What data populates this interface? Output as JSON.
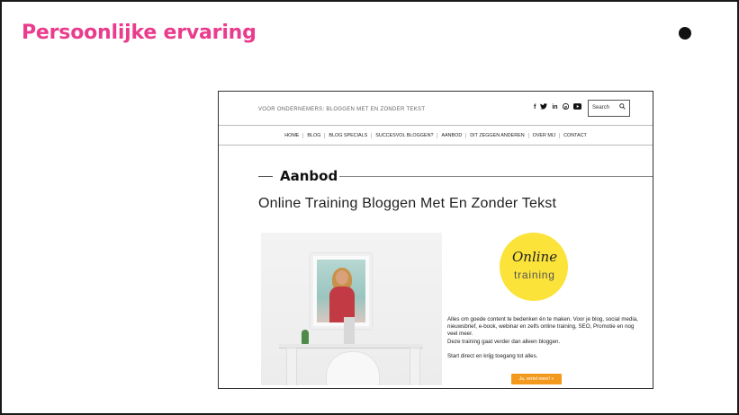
{
  "slide": {
    "title": "Persoonlijke ervaring"
  },
  "site": {
    "tagline": "VOOR ONDERNEMERS: BLOGGEN MET EN ZONDER TEKST",
    "social": [
      "f",
      "♥",
      "in",
      "℗",
      "■"
    ],
    "search_placeholder": "Search",
    "nav": [
      "HOME",
      "BLOG",
      "BLOG SPECIALS",
      "SUCCESVOL BLOGGEN?",
      "AANBOD",
      "DIT ZEGGEN ANDEREN",
      "OVER MIJ",
      "CONTACT"
    ],
    "section_label": "Aanbod",
    "page_heading": "Online Training Bloggen Met En Zonder Tekst",
    "logo": {
      "script": "Online",
      "word": "training"
    },
    "description": [
      "Alles om goede content te bedenken én te maken. Voor je blog, social media, nieuwsbrief, e-book, webinar en zelfs online training, SEO, Promotie en nog veel meer.",
      "Deze training gaat verder dan alleen bloggen."
    ],
    "start_text": "Start direct en krijg toegang tot alles.",
    "cta_label": "Ja, vertel meer! »"
  },
  "colors": {
    "title_pink": "#ea3c8d",
    "logo_yellow": "#fbe33a",
    "cta_orange": "#f39a1e"
  }
}
